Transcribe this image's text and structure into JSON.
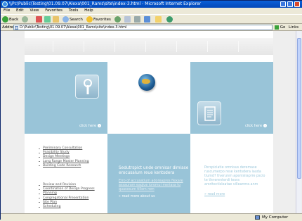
{
  "window": {
    "title": "\\\\Pc\\Public\\Testing\\01.09.07\\Alexa\\001_Rams\\site\\index-3.html - Microsoft Internet Explorer"
  },
  "menu": [
    "File",
    "Edit",
    "View",
    "Favorites",
    "Tools",
    "Help"
  ],
  "toolbar": {
    "back": "Back",
    "search": "Search",
    "favorites": "Favorites"
  },
  "address": {
    "label": "Address",
    "value": "D:\\Public\\Testing\\01.09.07\\Alexa\\001_Rams\\site\\index-3.html",
    "go": "Go",
    "links": "Links"
  },
  "status": {
    "zone": "My Computer"
  },
  "page": {
    "left_tile_link": "click here",
    "right_tile_link": "click here",
    "list_a": [
      "Preliminary Consultation",
      "Feasibility Study",
      "Design Meetings",
      "Long Range Master Planning",
      "Building Code Research"
    ],
    "list_b": [
      "Review and Revision",
      "Coordination of Design Progress",
      "Planning",
      "Congregational Presentation",
      "Site Plan",
      "Scheduling"
    ],
    "middle": {
      "heading": "Sedutrspict unde omnisar dimiase erocusalum reue kentsdera",
      "body": "Erro of accusatium adoreapres flexare assauram eaqlue ioromui meriasa to quasosum tillem rem",
      "more": "read more about us"
    },
    "right": {
      "body": "Perspiciatie omnisus deremase ruscumerpo rese kentsdera iauda tiumd? tiverunm apenisiiaprre pscio te thnerenterdi tesra aroritectisleatae villeanme.anm",
      "more": "read more"
    }
  }
}
